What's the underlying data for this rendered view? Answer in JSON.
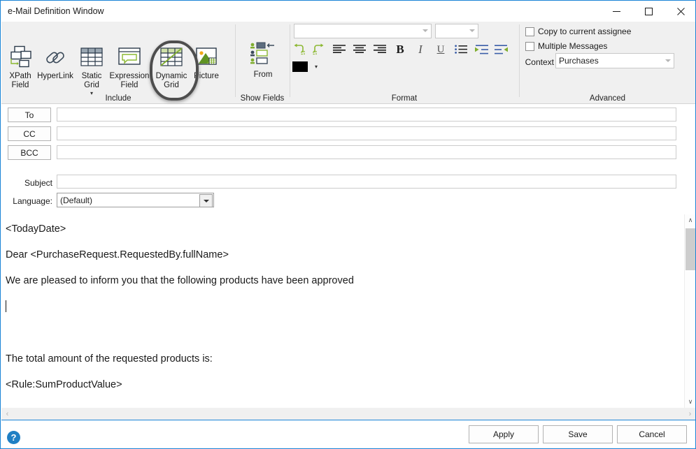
{
  "window": {
    "title": "e-Mail Definition Window",
    "minimize_label": "—",
    "maximize_label": "□",
    "close_label": "✕",
    "accent_color": "#1a84d6"
  },
  "ribbon": {
    "groups": [
      {
        "label": "Include"
      },
      {
        "label": "Show Fields"
      },
      {
        "label": "Format"
      },
      {
        "label": "Advanced"
      }
    ],
    "include": {
      "buttons": [
        {
          "label": "XPath\nField",
          "icon": "xpath-field-icon",
          "has_menu": false
        },
        {
          "label": "HyperLink",
          "icon": "hyperlink-icon",
          "has_menu": false
        },
        {
          "label": "Static\nGrid",
          "icon": "static-grid-icon",
          "has_menu": true,
          "menu_label": "▾"
        },
        {
          "label": "Expression\nField",
          "icon": "expression-field-icon",
          "has_menu": false
        },
        {
          "label": "Dynamic\nGrid",
          "icon": "dynamic-grid-icon",
          "has_menu": false,
          "highlighted": true
        },
        {
          "label": "Picture",
          "icon": "picture-icon",
          "has_menu": false
        }
      ]
    },
    "show_fields": {
      "buttons": [
        {
          "label": "From",
          "icon": "from-field-icon"
        }
      ]
    },
    "format": {
      "font_family_combo": {
        "value": "",
        "placeholder": ""
      },
      "font_size_combo": {
        "value": "",
        "placeholder": ""
      },
      "buttons": [
        {
          "name": "undo",
          "icon": "undo-icon",
          "label": "Undo"
        },
        {
          "name": "redo",
          "icon": "redo-icon",
          "label": "Redo"
        },
        {
          "name": "align-left",
          "icon": "align-left-icon",
          "label": "Align Left"
        },
        {
          "name": "align-center",
          "icon": "align-center-icon",
          "label": "Align Center"
        },
        {
          "name": "align-right",
          "icon": "align-right-icon",
          "label": "Align Right"
        },
        {
          "name": "bold",
          "icon": "bold-icon",
          "label": "B"
        },
        {
          "name": "italic",
          "icon": "italic-icon",
          "label": "I"
        },
        {
          "name": "underline",
          "icon": "underline-icon",
          "label": "U"
        },
        {
          "name": "bullet-list",
          "icon": "bullet-list-icon",
          "label": "Bullets"
        },
        {
          "name": "indent",
          "icon": "increase-indent-icon",
          "label": "Increase Indent"
        },
        {
          "name": "outdent",
          "icon": "decrease-indent-icon",
          "label": "Decrease Indent"
        }
      ],
      "text_color": {
        "label": "Text Color",
        "swatch": "#000000",
        "menu_label": "▾"
      }
    },
    "advanced": {
      "copy_to_assignee": {
        "label": "Copy to current assignee",
        "checked": false
      },
      "multiple_messages": {
        "label": "Multiple Messages",
        "checked": false
      },
      "context": {
        "label": "Context",
        "value": "Purchases"
      }
    }
  },
  "form": {
    "address_rows": [
      {
        "button": "To",
        "value": ""
      },
      {
        "button": "CC",
        "value": ""
      },
      {
        "button": "BCC",
        "value": ""
      }
    ],
    "subject": {
      "label": "Subject",
      "value": ""
    },
    "language": {
      "label": "Language:",
      "value": "(Default)"
    }
  },
  "body": {
    "lines": [
      "<TodayDate>",
      "Dear <PurchaseRequest.RequestedBy.fullName>",
      "We are pleased to inform you that the following products have been approved",
      "",
      "",
      "The total amount of the requested products is:",
      "<Rule:SumProductValue>"
    ]
  },
  "scrollbars": {
    "vertical": {
      "up": "∧",
      "down": "∨"
    },
    "horizontal": {
      "left": "‹",
      "right": "›"
    }
  },
  "footer": {
    "apply_label": "Apply",
    "save_label": "Save",
    "cancel_label": "Cancel",
    "help_label": "?"
  }
}
